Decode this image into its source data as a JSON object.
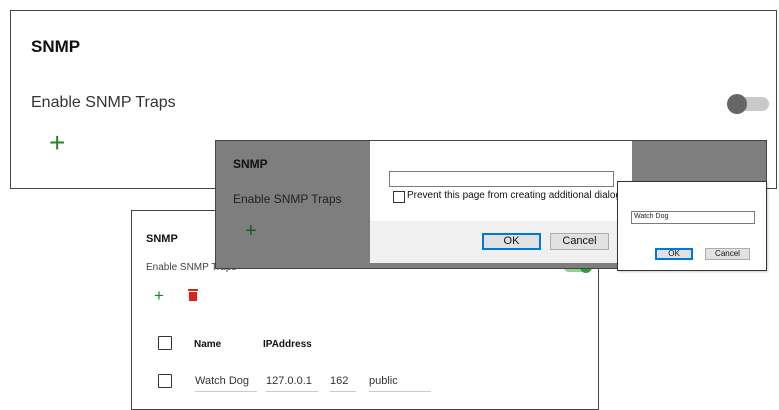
{
  "panel_main": {
    "title": "SNMP",
    "enable_label": "Enable SNMP Traps",
    "add_glyph": "+"
  },
  "panel_table": {
    "title": "SNMP",
    "enable_label": "Enable SNMP Traps",
    "add_glyph": "+",
    "columns": [
      "Name",
      "IPAddress"
    ],
    "rows": [
      {
        "name": "Watch Dog",
        "ip": "127.0.0.1",
        "port": "162",
        "community": "public"
      }
    ]
  },
  "panel_overlay": {
    "title": "SNMP",
    "enable_label": "Enable SNMP Traps",
    "add_glyph": "+"
  },
  "prompt_dialog": {
    "input_value": "",
    "checkbox_label": "Prevent this page from creating additional dialogs",
    "ok_label": "OK",
    "cancel_label": "Cancel"
  },
  "small_dialog": {
    "input_value": "Watch Dog",
    "ok_label": "OK",
    "cancel_label": "Cancel"
  },
  "colors": {
    "add_green": "#1f8a1f",
    "delete_red": "#e0201b",
    "toggle_on": "#2e9e3a",
    "overlay_grey": "#7e7e7e"
  }
}
